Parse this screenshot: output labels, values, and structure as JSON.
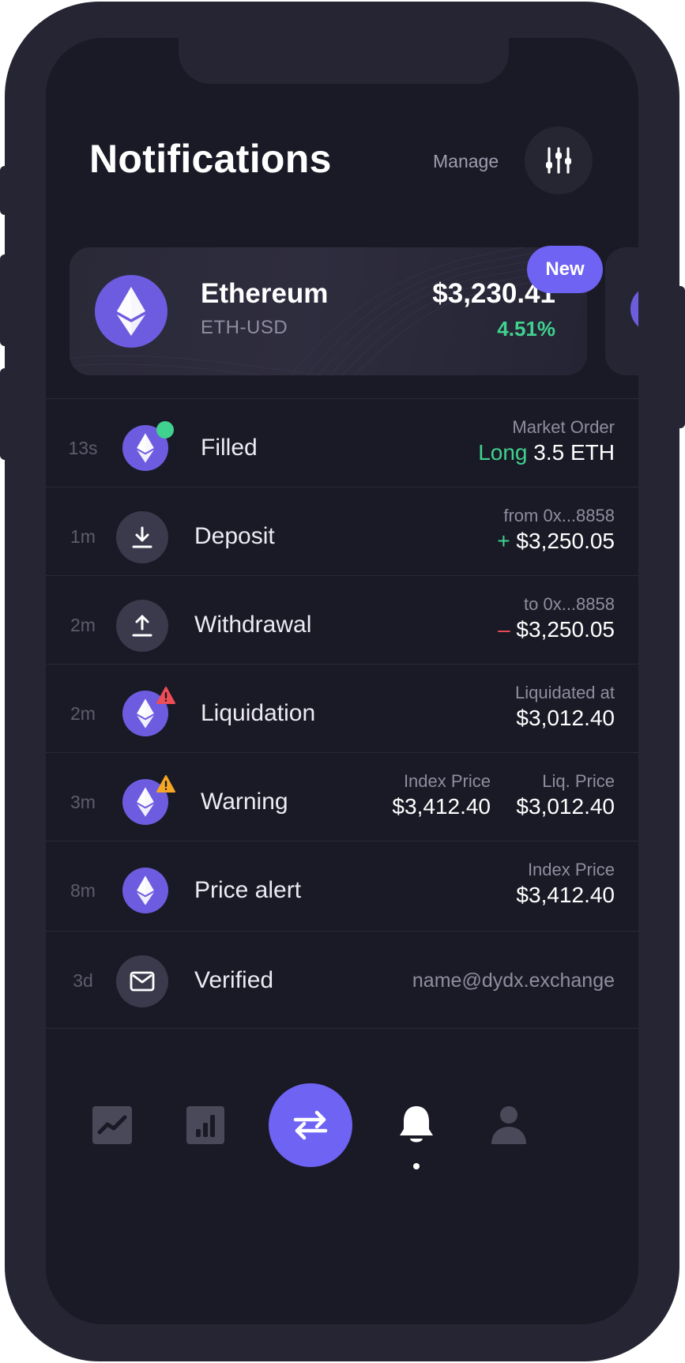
{
  "header": {
    "title": "Notifications",
    "manage_label": "Manage",
    "manage_icon": "sliders-icon"
  },
  "market_card": {
    "coin_icon": "ethereum-icon",
    "name": "Ethereum",
    "pair": "ETH-USD",
    "price": "$3,230.41",
    "change": "4.51%",
    "badge": "New"
  },
  "notifications": [
    {
      "time": "13s",
      "icon": "ethereum-icon",
      "indicator": "green-dot",
      "label": "Filled",
      "detail_title": "Market Order",
      "side": "Long",
      "amount": "3.5 ETH"
    },
    {
      "time": "1m",
      "icon": "download-icon",
      "label": "Deposit",
      "detail_title": "from 0x...8858",
      "sign": "+",
      "amount": "$3,250.05"
    },
    {
      "time": "2m",
      "icon": "upload-icon",
      "label": "Withdrawal",
      "detail_title": "to 0x...8858",
      "sign": "–",
      "amount": "$3,250.05"
    },
    {
      "time": "2m",
      "icon": "ethereum-icon",
      "indicator": "red-alert",
      "label": "Liquidation",
      "detail_title": "Liquidated at",
      "amount": "$3,012.40"
    },
    {
      "time": "3m",
      "icon": "ethereum-icon",
      "indicator": "orange-warning",
      "label": "Warning",
      "index_title": "Index Price",
      "index_value": "$3,412.40",
      "liq_title": "Liq. Price",
      "liq_value": "$3,012.40"
    },
    {
      "time": "8m",
      "icon": "ethereum-icon",
      "label": "Price alert",
      "detail_title": "Index Price",
      "amount": "$3,412.40"
    },
    {
      "time": "3d",
      "icon": "mail-icon",
      "label": "Verified",
      "email": "name@dydx.exchange"
    }
  ],
  "tabbar": {
    "items": [
      "chart-line-icon",
      "bar-chart-icon",
      "swap-icon",
      "bell-icon",
      "profile-icon"
    ],
    "active": "bell-icon"
  },
  "colors": {
    "background": "#1a1a26",
    "accent": "#6e63f3",
    "coin": "#6e5ce0",
    "positive": "#40d28f",
    "negative": "#ef4d56",
    "warning": "#f5a623"
  }
}
